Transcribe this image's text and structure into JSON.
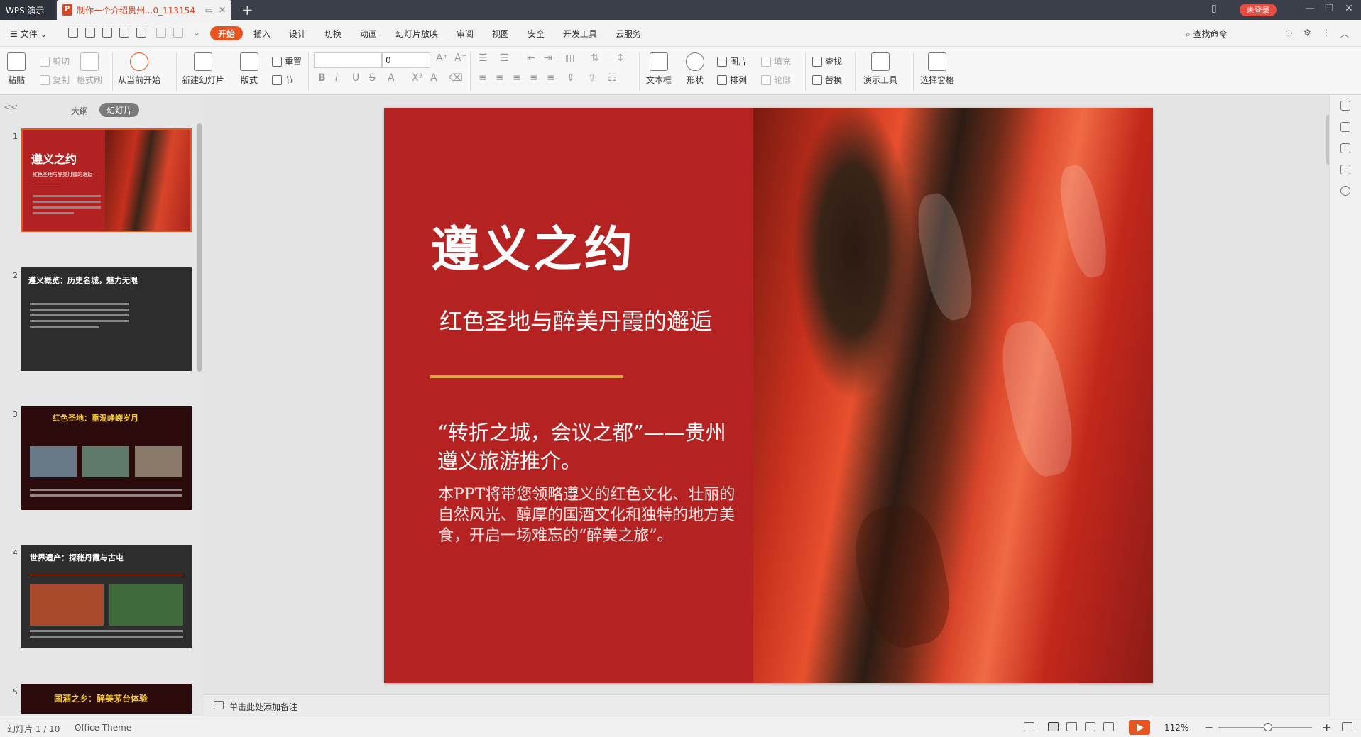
{
  "titlebar": {
    "app_label": "WPS 演示",
    "doc_tab_title": "制作一个介绍贵州...0_113154",
    "new_tab": "+",
    "login_label": "未登录"
  },
  "menu": {
    "file": "文件",
    "tabs": [
      "开始",
      "插入",
      "设计",
      "切换",
      "动画",
      "幻灯片放映",
      "审阅",
      "视图",
      "安全",
      "开发工具",
      "云服务"
    ],
    "search_cmd": "查找命令"
  },
  "ribbon": {
    "paste": "粘贴",
    "cut": "剪切",
    "copy": "复制",
    "format_painter": "格式刷",
    "from_current": "从当前开始",
    "new_slide": "新建幻灯片",
    "layout": "版式",
    "reset": "重置",
    "section": "节",
    "font_size_value": "0",
    "text_box": "文本框",
    "shape": "形状",
    "picture": "图片",
    "arrange": "排列",
    "fill": "填充",
    "outline": "轮廓",
    "find": "查找",
    "replace": "替换",
    "present_tools": "演示工具",
    "select_pane": "选择窗格"
  },
  "leftpanel": {
    "collapse": "<<",
    "tab_outline": "大纲",
    "tab_slides": "幻灯片",
    "thumbs": [
      {
        "num": "1",
        "title": "遵义之约",
        "sub": "红色圣地与醉美丹霞的邂逅"
      },
      {
        "num": "2",
        "title": "遵义概览：历史名城，魅力无限"
      },
      {
        "num": "3",
        "title": "红色圣地：重温峥嵘岁月"
      },
      {
        "num": "4",
        "title": "世界遗产：探秘丹霞与古屯"
      },
      {
        "num": "5",
        "title": "国酒之乡：醉美茅台体验"
      }
    ]
  },
  "slide": {
    "title": "遵义之约",
    "subtitle": "红色圣地与醉美丹霞的邂逅",
    "quote": "“转折之城，会议之都”——贵州遵义旅游推介。",
    "body": "本PPT将带您领略遵义的红色文化、壮丽的自然风光、醇厚的国酒文化和独特的地方美食，开启一场难忘的“醉美之旅”。"
  },
  "notes": {
    "placeholder": "单击此处添加备注"
  },
  "status": {
    "slide_counter": "幻灯片 1 / 10",
    "theme": "Office Theme",
    "zoom": "112%"
  }
}
